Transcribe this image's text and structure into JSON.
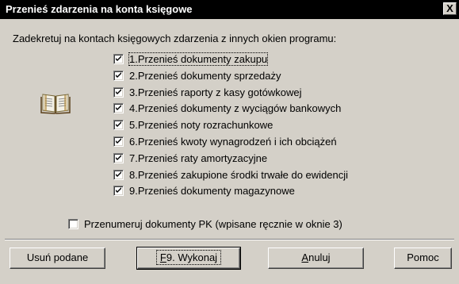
{
  "window": {
    "title": "Przenieś zdarzenia na konta księgowe",
    "close_label": "X"
  },
  "prompt": "Zadekretuj na kontach księgowych zdarzenia z innych okien programu:",
  "options": [
    {
      "label": "1.Przenieś dokumenty zakupu",
      "checked": true
    },
    {
      "label": "2.Przenieś dokumenty sprzedaży",
      "checked": true
    },
    {
      "label": "3.Przenieś raporty z kasy gotówkowej",
      "checked": true
    },
    {
      "label": "4.Przenieś dokumenty z wyciągów bankowych",
      "checked": true
    },
    {
      "label": "5.Przenieś noty rozrachunkowe",
      "checked": true
    },
    {
      "label": "6.Przenieś kwoty wynagrodzeń i ich obciążeń",
      "checked": true
    },
    {
      "label": "7.Przenieś raty amortyzacyjne",
      "checked": true
    },
    {
      "label": "8.Przenieś zakupione środki trwałe do ewidencji",
      "checked": true
    },
    {
      "label": "9.Przenieś dokumenty magazynowe",
      "checked": true
    }
  ],
  "renumber": {
    "label": "Przenumeruj dokumenty PK (wpisane ręcznie w oknie 3)",
    "checked": false
  },
  "buttons": {
    "remove": "Usuń podane",
    "execute_prefix": "F",
    "execute_rest": "9. Wykonaj",
    "cancel_prefix": "A",
    "cancel_rest": "nuluj",
    "help": "Pomoc"
  },
  "icon": "book-icon"
}
